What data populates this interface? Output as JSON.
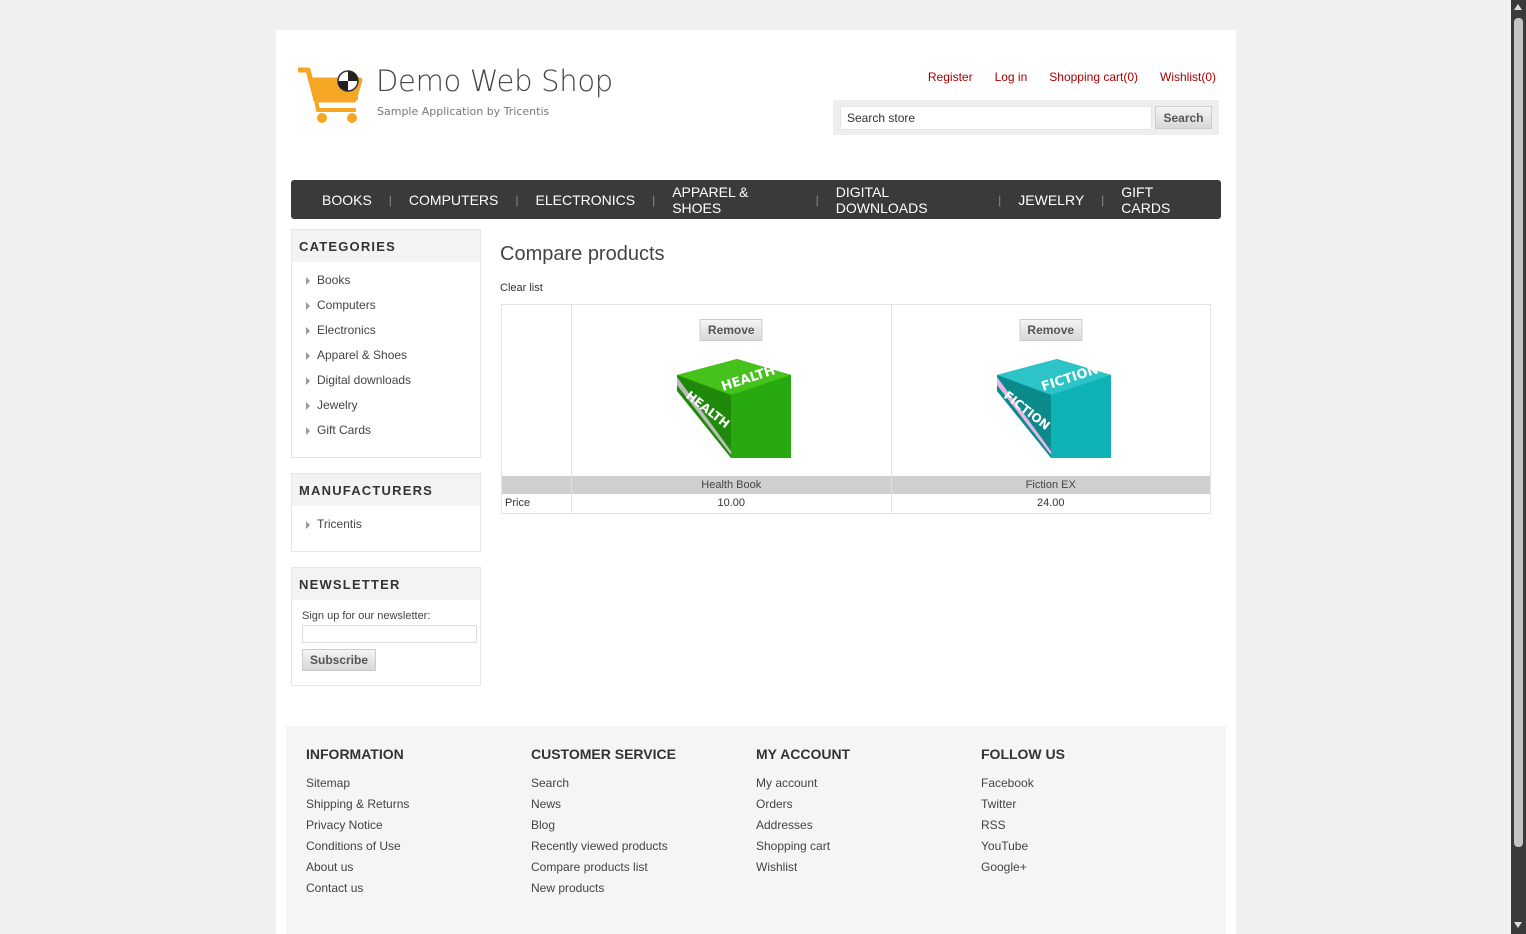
{
  "header": {
    "title": "Demo Web Shop",
    "subtitle": "Sample Application by Tricentis",
    "links": [
      "Register",
      "Log in",
      "Shopping cart(0)",
      "Wishlist(0)"
    ],
    "search_value": "Search store",
    "search_button": "Search"
  },
  "topmenu": [
    "BOOKS",
    "COMPUTERS",
    "ELECTRONICS",
    "APPAREL & SHOES",
    "DIGITAL DOWNLOADS",
    "JEWELRY",
    "GIFT CARDS"
  ],
  "categories": {
    "title": "CATEGORIES",
    "items": [
      "Books",
      "Computers",
      "Electronics",
      "Apparel & Shoes",
      "Digital downloads",
      "Jewelry",
      "Gift Cards"
    ]
  },
  "manufacturers": {
    "title": "MANUFACTURERS",
    "items": [
      "Tricentis"
    ]
  },
  "newsletter": {
    "title": "NEWSLETTER",
    "label": "Sign up for our newsletter:",
    "button": "Subscribe"
  },
  "main": {
    "title": "Compare products",
    "clear_list": "Clear list",
    "remove_label": "Remove",
    "price_label": "Price",
    "products": [
      {
        "name": "Health Book",
        "price": "10.00",
        "cover_text": "HEALTH",
        "color": "#3db018"
      },
      {
        "name": "Fiction EX",
        "price": "24.00",
        "cover_text": "FICTION",
        "color": "#14b5b7"
      }
    ]
  },
  "footer": {
    "columns": [
      {
        "title": "INFORMATION",
        "links": [
          "Sitemap",
          "Shipping & Returns",
          "Privacy Notice",
          "Conditions of Use",
          "About us",
          "Contact us"
        ]
      },
      {
        "title": "CUSTOMER SERVICE",
        "links": [
          "Search",
          "News",
          "Blog",
          "Recently viewed products",
          "Compare products list",
          "New products"
        ]
      },
      {
        "title": "MY ACCOUNT",
        "links": [
          "My account",
          "Orders",
          "Addresses",
          "Shopping cart",
          "Wishlist"
        ]
      },
      {
        "title": "FOLLOW US",
        "links": [
          "Facebook",
          "Twitter",
          "RSS",
          "YouTube",
          "Google+"
        ]
      }
    ]
  },
  "colors": {
    "link": "#aa0000",
    "menu_bg": "#3a3a3a",
    "logo_orange": "#f5a623"
  }
}
